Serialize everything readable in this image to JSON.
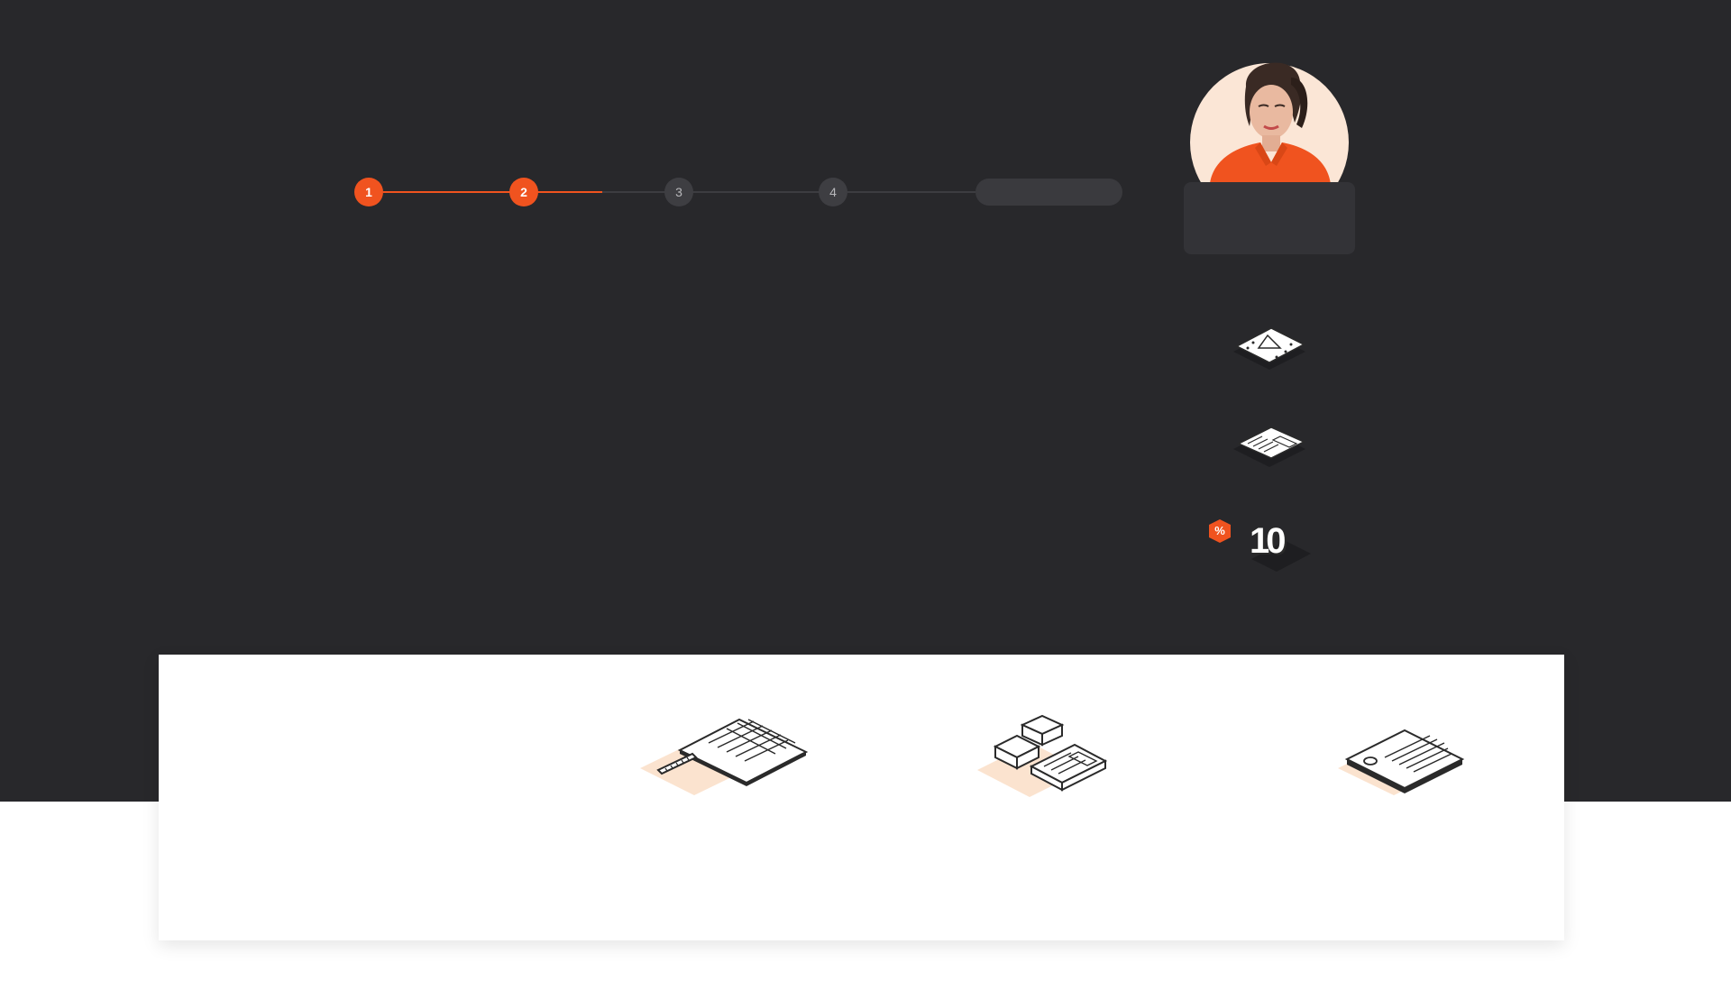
{
  "colors": {
    "background_dark": "#28282b",
    "accent": "#f0531f",
    "step_inactive": "#3e3e42",
    "panel": "#ffffff",
    "illustration_tint": "#fbe3cf"
  },
  "stepper": {
    "steps": [
      {
        "label": "1",
        "state": "completed"
      },
      {
        "label": "2",
        "state": "current"
      },
      {
        "label": "3",
        "state": "upcoming"
      },
      {
        "label": "4",
        "state": "upcoming"
      }
    ],
    "final_step": ""
  },
  "consultant": {
    "name": "",
    "subtitle": ""
  },
  "side_icons": [
    {
      "icon": "map-icon"
    },
    {
      "icon": "calculator-icon"
    },
    {
      "icon": "discount-10-icon",
      "badge": "%",
      "number": "10"
    }
  ],
  "features": [
    {
      "icon": "blueprint-ruler-icon"
    },
    {
      "icon": "calculator-blocks-icon"
    },
    {
      "icon": "document-icon"
    }
  ]
}
